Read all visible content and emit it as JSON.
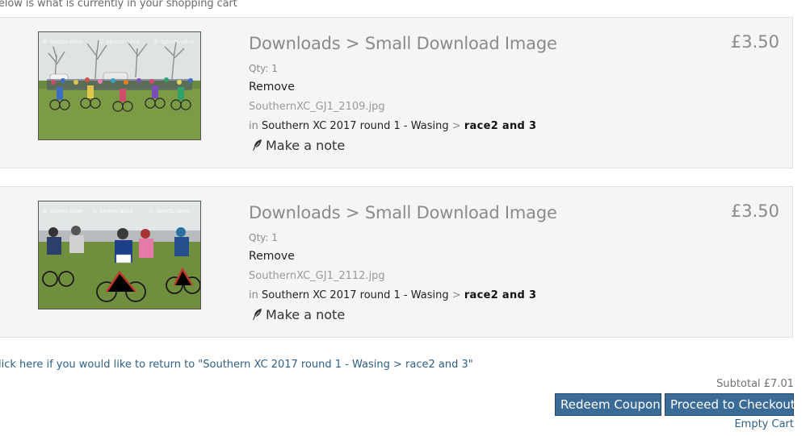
{
  "cart": {
    "intro": "elow is what is currently in your shopping cart",
    "items": [
      {
        "title": "Downloads > Small Download Image",
        "price": "£3.50",
        "qty": "Qty: 1",
        "remove_label": "Remove",
        "filename": "SouthernXC_GJ1_2109.jpg",
        "in_label": "in",
        "gallery": "Southern XC 2017 round 1 - Wasing",
        "separator": ">",
        "subgallery": "race2 and 3",
        "note_label": "Make a note",
        "icon": "feather-icon",
        "watermark": "© Sports-alive"
      },
      {
        "title": "Downloads > Small Download Image",
        "price": "£3.50",
        "qty": "Qty: 1",
        "remove_label": "Remove",
        "filename": "SouthernXC_GJ1_2112.jpg",
        "in_label": "in",
        "gallery": "Southern XC 2017 round 1 - Wasing",
        "separator": ">",
        "subgallery": "race2 and 3",
        "note_label": "Make a note",
        "icon": "feather-icon",
        "watermark": "© Sports-alive"
      }
    ],
    "return_link": "lick here if you would like to return to \"Southern XC 2017 round 1 - Wasing > race2 and 3\"",
    "subtotal": "Subtotal £7.01",
    "redeem_label": "Redeem Coupon",
    "checkout_label": "Proceed to Checkout",
    "empty_label": "Empty Cart"
  },
  "colors": {
    "button_bg": "#3b6b97",
    "link": "#2f5f85",
    "item_bg": "#f5f5f5"
  }
}
